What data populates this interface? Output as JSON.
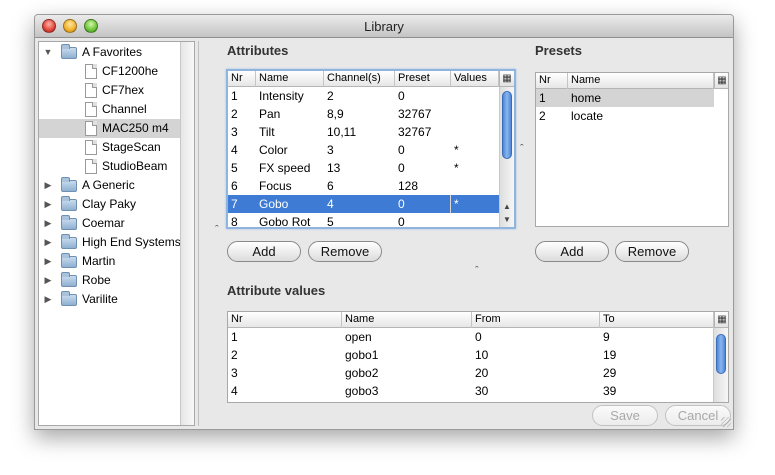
{
  "window": {
    "title": "Library"
  },
  "tree": {
    "items": [
      {
        "label": "A Favorites",
        "type": "folder",
        "level": 0,
        "expanded": true
      },
      {
        "label": "CF1200he",
        "type": "file",
        "level": 1
      },
      {
        "label": "CF7hex",
        "type": "file",
        "level": 1
      },
      {
        "label": "Channel",
        "type": "file",
        "level": 1
      },
      {
        "label": "MAC250 m4",
        "type": "file",
        "level": 1,
        "selected": true
      },
      {
        "label": "StageScan",
        "type": "file",
        "level": 1
      },
      {
        "label": "StudioBeam",
        "type": "file",
        "level": 1
      },
      {
        "label": "A Generic",
        "type": "folder",
        "level": 0,
        "expanded": false
      },
      {
        "label": "Clay Paky",
        "type": "folder",
        "level": 0,
        "expanded": false
      },
      {
        "label": "Coemar",
        "type": "folder",
        "level": 0,
        "expanded": false
      },
      {
        "label": "High End Systems",
        "type": "folder",
        "level": 0,
        "expanded": false
      },
      {
        "label": "Martin",
        "type": "folder",
        "level": 0,
        "expanded": false
      },
      {
        "label": "Robe",
        "type": "folder",
        "level": 0,
        "expanded": false
      },
      {
        "label": "Varilite",
        "type": "folder",
        "level": 0,
        "expanded": false
      }
    ]
  },
  "attributes": {
    "title": "Attributes",
    "columns": [
      "Nr",
      "Name",
      "Channel(s)",
      "Preset",
      "Values"
    ],
    "rows": [
      [
        "1",
        "Intensity",
        "2",
        "0",
        ""
      ],
      [
        "2",
        "Pan",
        "8,9",
        "32767",
        ""
      ],
      [
        "3",
        "Tilt",
        "10,11",
        "32767",
        ""
      ],
      [
        "4",
        "Color",
        "3",
        "0",
        "*"
      ],
      [
        "5",
        "FX speed",
        "13",
        "0",
        "*"
      ],
      [
        "6",
        "Focus",
        "6",
        "128",
        ""
      ],
      [
        "7",
        "Gobo",
        "4",
        "0",
        "*"
      ],
      [
        "8",
        "Gobo Rot",
        "5",
        "0",
        ""
      ]
    ],
    "selected_row": 6,
    "add_label": "Add",
    "remove_label": "Remove"
  },
  "presets": {
    "title": "Presets",
    "columns": [
      "Nr",
      "Name"
    ],
    "rows": [
      [
        "1",
        "home"
      ],
      [
        "2",
        "locate"
      ]
    ],
    "selected_row": 0,
    "add_label": "Add",
    "remove_label": "Remove"
  },
  "attribute_values": {
    "title": "Attribute values",
    "columns": [
      "Nr",
      "Name",
      "From",
      "To"
    ],
    "rows": [
      [
        "1",
        "open",
        "0",
        "9"
      ],
      [
        "2",
        "gobo1",
        "10",
        "19"
      ],
      [
        "3",
        "gobo2",
        "20",
        "29"
      ],
      [
        "4",
        "gobo3",
        "30",
        "39"
      ]
    ]
  },
  "footer": {
    "save_label": "Save",
    "cancel_label": "Cancel"
  },
  "icons": {
    "column_picker": "column-picker-icon",
    "expand": "disclosure-expanded-icon",
    "collapse": "disclosure-collapsed-icon"
  },
  "colors": {
    "selection": "#3d7bd4",
    "tree_selection": "#d4d4d4",
    "focus_ring": "#8fb4de"
  }
}
